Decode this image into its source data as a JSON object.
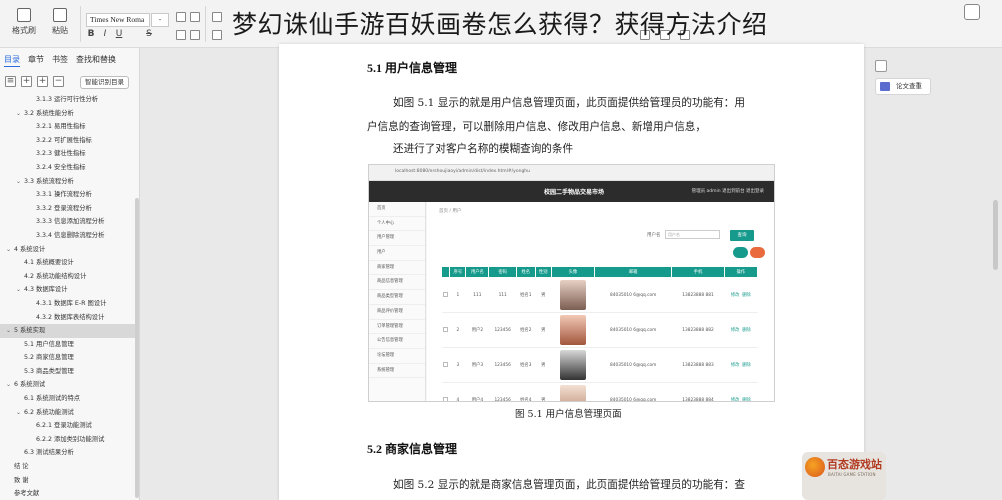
{
  "headline": "梦幻诛仙手游百妖画卷怎么获得？获得方法介绍",
  "toolbar": {
    "format_painter_label": "格式刷",
    "paste_label": "粘贴",
    "font_name": "Times New Roma",
    "font_size": "-",
    "bold": "B",
    "italic": "I",
    "underline": "U",
    "strike": "S"
  },
  "leftnav": {
    "tabs": [
      {
        "label": "目录",
        "active": true
      },
      {
        "label": "章节",
        "active": false
      },
      {
        "label": "书签",
        "active": false
      },
      {
        "label": "查找和替换",
        "active": false
      }
    ],
    "tools": [
      "≡",
      "+",
      "+",
      "−"
    ],
    "smart_button": "智能识别目录",
    "toc": [
      {
        "label": "3.1.3 运行可行性分析",
        "level": 3,
        "caret": "",
        "active": false
      },
      {
        "label": "3.2 系统性能分析",
        "level": 2,
        "caret": "⌄",
        "active": false
      },
      {
        "label": "3.2.1 易用性指标",
        "level": 3,
        "caret": "",
        "active": false
      },
      {
        "label": "3.2.2 可扩展性指标",
        "level": 3,
        "caret": "",
        "active": false
      },
      {
        "label": "3.2.3 健壮性指标",
        "level": 3,
        "caret": "",
        "active": false
      },
      {
        "label": "3.2.4 安全性指标",
        "level": 3,
        "caret": "",
        "active": false
      },
      {
        "label": "3.3 系统流程分析",
        "level": 2,
        "caret": "⌄",
        "active": false
      },
      {
        "label": "3.3.1 操作流程分析",
        "level": 3,
        "caret": "",
        "active": false
      },
      {
        "label": "3.3.2 登录流程分析",
        "level": 3,
        "caret": "",
        "active": false
      },
      {
        "label": "3.3.3 信息添加流程分析",
        "level": 3,
        "caret": "",
        "active": false
      },
      {
        "label": "3.3.4 信息删除流程分析",
        "level": 3,
        "caret": "",
        "active": false
      },
      {
        "label": "4 系统设计",
        "level": 1,
        "caret": "⌄",
        "active": false
      },
      {
        "label": "4.1 系统概要设计",
        "level": 2,
        "caret": "",
        "active": false
      },
      {
        "label": "4.2 系统功能结构设计",
        "level": 2,
        "caret": "",
        "active": false
      },
      {
        "label": "4.3 数据库设计",
        "level": 2,
        "caret": "⌄",
        "active": false
      },
      {
        "label": "4.3.1 数据库 E-R 图设计",
        "level": 3,
        "caret": "",
        "active": false
      },
      {
        "label": "4.3.2 数据库表结构设计",
        "level": 3,
        "caret": "",
        "active": false
      },
      {
        "label": "5 系统实现",
        "level": 1,
        "caret": "⌄",
        "active": true
      },
      {
        "label": "5.1 用户信息管理",
        "level": 2,
        "caret": "",
        "active": false
      },
      {
        "label": "5.2 商家信息管理",
        "level": 2,
        "caret": "",
        "active": false
      },
      {
        "label": "5.3 商品类型管理",
        "level": 2,
        "caret": "",
        "active": false
      },
      {
        "label": "6 系统测试",
        "level": 1,
        "caret": "⌄",
        "active": false
      },
      {
        "label": "6.1 系统测试的特点",
        "level": 2,
        "caret": "",
        "active": false
      },
      {
        "label": "6.2 系统功能测试",
        "level": 2,
        "caret": "⌄",
        "active": false
      },
      {
        "label": "6.2.1 登录功能测试",
        "level": 3,
        "caret": "",
        "active": false
      },
      {
        "label": "6.2.2 添加类别功能测试",
        "level": 3,
        "caret": "",
        "active": false
      },
      {
        "label": "6.3 测试结果分析",
        "level": 2,
        "caret": "",
        "active": false
      },
      {
        "label": "结 论",
        "level": 1,
        "caret": "",
        "active": false
      },
      {
        "label": "致 谢",
        "level": 1,
        "caret": "",
        "active": false
      },
      {
        "label": "参考文献",
        "level": 1,
        "caret": "",
        "active": false
      }
    ]
  },
  "document": {
    "section1_title": "5.1 用户信息管理",
    "para1_line1": "如图 5.1 显示的就是用户信息管理页面，此页面提供给管理员的功能有：用",
    "para1_line2": "户信息的查询管理，可以删除用户信息、修改用户信息、新增用户信息，",
    "para1_line3": "还进行了对客户名称的模糊查询的条件",
    "figure_caption": "图 5.1  用户信息管理页面",
    "section2_title": "5.2 商家信息管理",
    "para2_line1": "如图 5.2 显示的就是商家信息管理页面，此页面提供给管理员的功能有：查"
  },
  "screenshot": {
    "url": "localhost:8080/ershoujiaoyi/admin/dist/index.html#/yonghu",
    "site_title": "校园二手物品交易市场",
    "header_right": "管理员 admin    退出到前台    退出登录",
    "crumb": "首页 / 用户",
    "side_items": [
      "首页",
      "个人中心",
      "用户管理",
      "用户",
      "商家管理",
      "商品信息管理",
      "商品类型管理",
      "商品评价管理",
      "订单管理管理",
      "公告信息管理",
      "论坛管理",
      "系统管理"
    ],
    "search_label": "用户名",
    "search_placeholder": "用户名",
    "search_button": "查询",
    "columns": [
      "",
      "序号",
      "用户名",
      "密码",
      "姓名",
      "性别",
      "头像",
      "邮箱",
      "手机",
      "操作"
    ],
    "rows": [
      {
        "idx": "1",
        "user": "111",
        "pass": "111",
        "name": "姓名1",
        "sex": "男",
        "email": "84035010 6@qq.com",
        "phone": "13823888 881"
      },
      {
        "idx": "2",
        "user": "用户2",
        "pass": "123456",
        "name": "姓名2",
        "sex": "男",
        "email": "84035010 6@qq.com",
        "phone": "13823888 882"
      },
      {
        "idx": "3",
        "user": "用户3",
        "pass": "123456",
        "name": "姓名3",
        "sex": "男",
        "email": "84035010 6@qq.com",
        "phone": "13823888 883"
      },
      {
        "idx": "4",
        "user": "用户4",
        "pass": "123456",
        "name": "姓名4",
        "sex": "男",
        "email": "84035010 6@qq.com",
        "phone": "13823888 884"
      }
    ],
    "op_edit": "修改",
    "op_delete": "删除",
    "accent": "#159a8c"
  },
  "rightpanel": {
    "word_count_label": "论文查重"
  },
  "watermark": {
    "title": "百态游戏站",
    "subtitle": "BAITAI GAME STATION"
  }
}
